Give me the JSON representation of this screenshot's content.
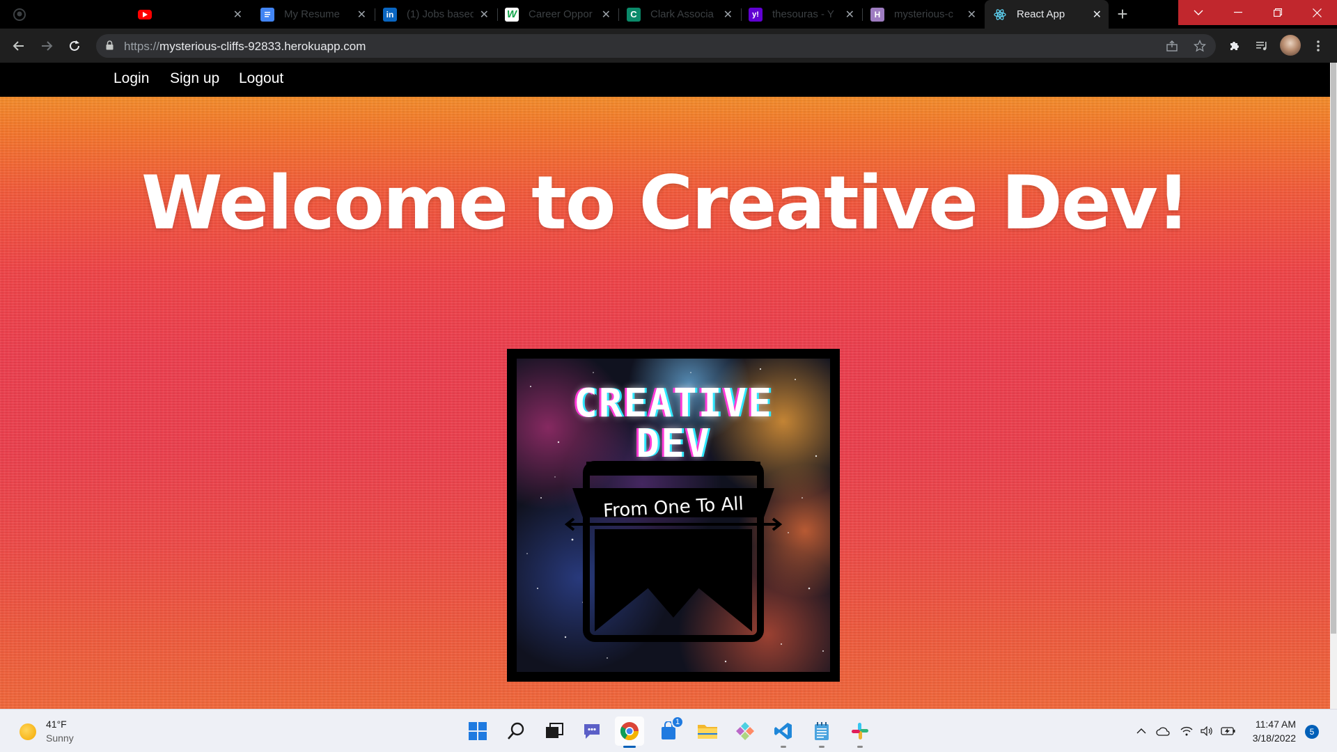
{
  "browser": {
    "tabs": [
      {
        "label": "",
        "icon": "github-icon"
      },
      {
        "label": "",
        "icon": "youtube-icon"
      },
      {
        "label": "My Resume",
        "icon": "google-docs-icon"
      },
      {
        "label": "(1) Jobs based",
        "icon": "linkedin-icon"
      },
      {
        "label": "Career Oppor",
        "icon": "upwork-icon"
      },
      {
        "label": "Clark Associa",
        "icon": "clark-icon"
      },
      {
        "label": "thesouras - Y",
        "icon": "yahoo-icon"
      },
      {
        "label": "mysterious-c",
        "icon": "heroku-icon"
      },
      {
        "label": "React App",
        "icon": "react-icon",
        "active": true
      }
    ],
    "url_scheme": "https://",
    "url_host": "mysterious-cliffs-92833.herokuapp.com"
  },
  "site": {
    "nav": {
      "login": "Login",
      "signup": "Sign up",
      "logout": "Logout"
    },
    "hero_title": "Welcome to Creative Dev!",
    "logo": {
      "title_line1": "CREATIVE",
      "title_line2": "DEV",
      "tagline": "From One To All"
    }
  },
  "taskbar": {
    "weather_temp": "41°F",
    "weather_desc": "Sunny",
    "time": "11:47 AM",
    "date": "3/18/2022",
    "notification_count": "5",
    "store_badge": "1"
  },
  "colors": {
    "accent": "#005fb8",
    "window_close_red": "#c1272d"
  }
}
